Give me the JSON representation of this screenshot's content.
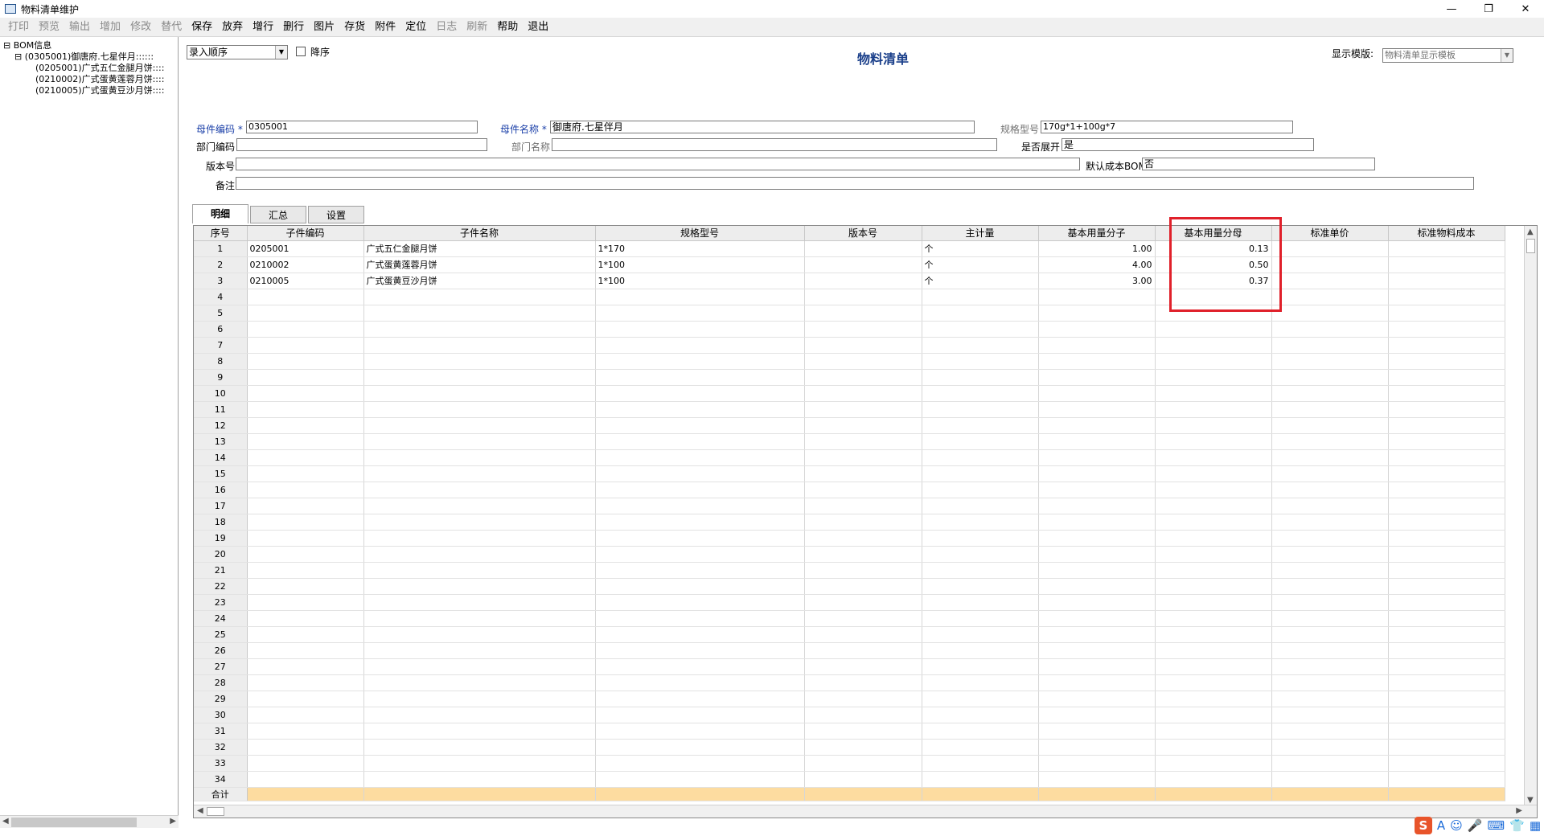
{
  "window": {
    "title": "物料清单维护",
    "min": "—",
    "max": "❐",
    "close": "✕"
  },
  "menu": [
    {
      "label": "打印",
      "enabled": false
    },
    {
      "label": "预览",
      "enabled": false
    },
    {
      "label": "输出",
      "enabled": false
    },
    {
      "label": "增加",
      "enabled": false
    },
    {
      "label": "修改",
      "enabled": false
    },
    {
      "label": "替代",
      "enabled": false
    },
    {
      "label": "保存",
      "enabled": true
    },
    {
      "label": "放弃",
      "enabled": true
    },
    {
      "label": "增行",
      "enabled": true
    },
    {
      "label": "删行",
      "enabled": true
    },
    {
      "label": "图片",
      "enabled": true
    },
    {
      "label": "存货",
      "enabled": true
    },
    {
      "label": "附件",
      "enabled": true
    },
    {
      "label": "定位",
      "enabled": true
    },
    {
      "label": "日志",
      "enabled": false
    },
    {
      "label": "刷新",
      "enabled": false
    },
    {
      "label": "帮助",
      "enabled": true
    },
    {
      "label": "退出",
      "enabled": true
    }
  ],
  "tree": {
    "root": "BOM信息",
    "node": "(0305001)御唐府.七星伴月::::::",
    "children": [
      "(0205001)广式五仁金腿月饼::::",
      "(0210002)广式蛋黄莲蓉月饼::::",
      "(0210005)广式蛋黄豆沙月饼::::"
    ]
  },
  "toolbar": {
    "sort_select": "录入顺序",
    "desc_label": "降序",
    "template_label": "显示模版:",
    "template_value": "物料清单显示模板"
  },
  "doc_title": "物料清单",
  "header": {
    "parent_code_label": "母件编码",
    "parent_code": "0305001",
    "parent_name_label": "母件名称",
    "parent_name": "御唐府.七星伴月",
    "spec_label": "规格型号",
    "spec": "170g*1+100g*7",
    "dept_code_label": "部门编码",
    "dept_code": "",
    "dept_name_label": "部门名称",
    "dept_name": "",
    "expand_label": "是否展开",
    "expand": "是",
    "version_label": "版本号",
    "version": "",
    "default_bom_label": "默认成本BOM",
    "default_bom": "否",
    "remark_label": "备注",
    "remark": "",
    "required_mark": "*"
  },
  "tabs": [
    "明细",
    "汇总",
    "设置"
  ],
  "table": {
    "columns": [
      "序号",
      "子件编码",
      "子件名称",
      "规格型号",
      "版本号",
      "主计量",
      "基本用量分子",
      "基本用量分母",
      "标准单价",
      "标准物料成本"
    ],
    "rows": [
      [
        "1",
        "0205001",
        "广式五仁金腿月饼",
        "1*170",
        "",
        "个",
        "1.00",
        "0.13",
        "",
        ""
      ],
      [
        "2",
        "0210002",
        "广式蛋黄莲蓉月饼",
        "1*100",
        "",
        "个",
        "4.00",
        "0.50",
        "",
        ""
      ],
      [
        "3",
        "0210005",
        "广式蛋黄豆沙月饼",
        "1*100",
        "",
        "个",
        "3.00",
        "0.37",
        "",
        ""
      ]
    ],
    "empty_row_numbers": [
      "4",
      "5",
      "6",
      "7",
      "8",
      "9",
      "10",
      "11",
      "12",
      "13",
      "14",
      "15",
      "16",
      "17",
      "18",
      "19",
      "20",
      "21",
      "22",
      "23",
      "24",
      "25",
      "26",
      "27",
      "28",
      "29",
      "30",
      "31",
      "32",
      "33",
      "34"
    ],
    "total_label": "合计"
  },
  "tray": {
    "ime": "S",
    "icons": [
      "A",
      "☺",
      "🎤",
      "⌨",
      "👕",
      "▦"
    ]
  },
  "colors": {
    "highlight": "#e0202a",
    "total_row": "#fddca0",
    "label_blue": "#1a3fa8"
  }
}
